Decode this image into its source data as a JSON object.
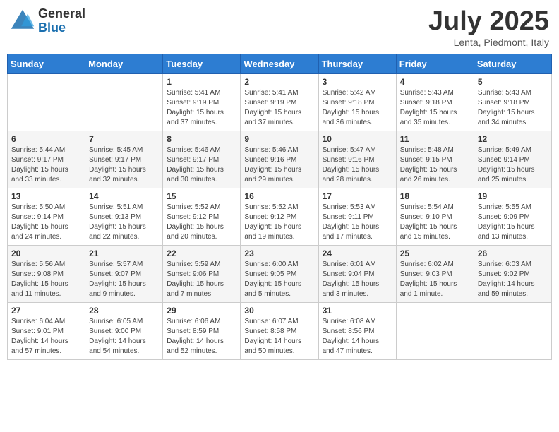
{
  "header": {
    "logo_general": "General",
    "logo_blue": "Blue",
    "month_title": "July 2025",
    "location": "Lenta, Piedmont, Italy"
  },
  "weekdays": [
    "Sunday",
    "Monday",
    "Tuesday",
    "Wednesday",
    "Thursday",
    "Friday",
    "Saturday"
  ],
  "weeks": [
    [
      {
        "day": "",
        "content": ""
      },
      {
        "day": "",
        "content": ""
      },
      {
        "day": "1",
        "sunrise": "Sunrise: 5:41 AM",
        "sunset": "Sunset: 9:19 PM",
        "daylight": "Daylight: 15 hours and 37 minutes."
      },
      {
        "day": "2",
        "sunrise": "Sunrise: 5:41 AM",
        "sunset": "Sunset: 9:19 PM",
        "daylight": "Daylight: 15 hours and 37 minutes."
      },
      {
        "day": "3",
        "sunrise": "Sunrise: 5:42 AM",
        "sunset": "Sunset: 9:18 PM",
        "daylight": "Daylight: 15 hours and 36 minutes."
      },
      {
        "day": "4",
        "sunrise": "Sunrise: 5:43 AM",
        "sunset": "Sunset: 9:18 PM",
        "daylight": "Daylight: 15 hours and 35 minutes."
      },
      {
        "day": "5",
        "sunrise": "Sunrise: 5:43 AM",
        "sunset": "Sunset: 9:18 PM",
        "daylight": "Daylight: 15 hours and 34 minutes."
      }
    ],
    [
      {
        "day": "6",
        "sunrise": "Sunrise: 5:44 AM",
        "sunset": "Sunset: 9:17 PM",
        "daylight": "Daylight: 15 hours and 33 minutes."
      },
      {
        "day": "7",
        "sunrise": "Sunrise: 5:45 AM",
        "sunset": "Sunset: 9:17 PM",
        "daylight": "Daylight: 15 hours and 32 minutes."
      },
      {
        "day": "8",
        "sunrise": "Sunrise: 5:46 AM",
        "sunset": "Sunset: 9:17 PM",
        "daylight": "Daylight: 15 hours and 30 minutes."
      },
      {
        "day": "9",
        "sunrise": "Sunrise: 5:46 AM",
        "sunset": "Sunset: 9:16 PM",
        "daylight": "Daylight: 15 hours and 29 minutes."
      },
      {
        "day": "10",
        "sunrise": "Sunrise: 5:47 AM",
        "sunset": "Sunset: 9:16 PM",
        "daylight": "Daylight: 15 hours and 28 minutes."
      },
      {
        "day": "11",
        "sunrise": "Sunrise: 5:48 AM",
        "sunset": "Sunset: 9:15 PM",
        "daylight": "Daylight: 15 hours and 26 minutes."
      },
      {
        "day": "12",
        "sunrise": "Sunrise: 5:49 AM",
        "sunset": "Sunset: 9:14 PM",
        "daylight": "Daylight: 15 hours and 25 minutes."
      }
    ],
    [
      {
        "day": "13",
        "sunrise": "Sunrise: 5:50 AM",
        "sunset": "Sunset: 9:14 PM",
        "daylight": "Daylight: 15 hours and 24 minutes."
      },
      {
        "day": "14",
        "sunrise": "Sunrise: 5:51 AM",
        "sunset": "Sunset: 9:13 PM",
        "daylight": "Daylight: 15 hours and 22 minutes."
      },
      {
        "day": "15",
        "sunrise": "Sunrise: 5:52 AM",
        "sunset": "Sunset: 9:12 PM",
        "daylight": "Daylight: 15 hours and 20 minutes."
      },
      {
        "day": "16",
        "sunrise": "Sunrise: 5:52 AM",
        "sunset": "Sunset: 9:12 PM",
        "daylight": "Daylight: 15 hours and 19 minutes."
      },
      {
        "day": "17",
        "sunrise": "Sunrise: 5:53 AM",
        "sunset": "Sunset: 9:11 PM",
        "daylight": "Daylight: 15 hours and 17 minutes."
      },
      {
        "day": "18",
        "sunrise": "Sunrise: 5:54 AM",
        "sunset": "Sunset: 9:10 PM",
        "daylight": "Daylight: 15 hours and 15 minutes."
      },
      {
        "day": "19",
        "sunrise": "Sunrise: 5:55 AM",
        "sunset": "Sunset: 9:09 PM",
        "daylight": "Daylight: 15 hours and 13 minutes."
      }
    ],
    [
      {
        "day": "20",
        "sunrise": "Sunrise: 5:56 AM",
        "sunset": "Sunset: 9:08 PM",
        "daylight": "Daylight: 15 hours and 11 minutes."
      },
      {
        "day": "21",
        "sunrise": "Sunrise: 5:57 AM",
        "sunset": "Sunset: 9:07 PM",
        "daylight": "Daylight: 15 hours and 9 minutes."
      },
      {
        "day": "22",
        "sunrise": "Sunrise: 5:59 AM",
        "sunset": "Sunset: 9:06 PM",
        "daylight": "Daylight: 15 hours and 7 minutes."
      },
      {
        "day": "23",
        "sunrise": "Sunrise: 6:00 AM",
        "sunset": "Sunset: 9:05 PM",
        "daylight": "Daylight: 15 hours and 5 minutes."
      },
      {
        "day": "24",
        "sunrise": "Sunrise: 6:01 AM",
        "sunset": "Sunset: 9:04 PM",
        "daylight": "Daylight: 15 hours and 3 minutes."
      },
      {
        "day": "25",
        "sunrise": "Sunrise: 6:02 AM",
        "sunset": "Sunset: 9:03 PM",
        "daylight": "Daylight: 15 hours and 1 minute."
      },
      {
        "day": "26",
        "sunrise": "Sunrise: 6:03 AM",
        "sunset": "Sunset: 9:02 PM",
        "daylight": "Daylight: 14 hours and 59 minutes."
      }
    ],
    [
      {
        "day": "27",
        "sunrise": "Sunrise: 6:04 AM",
        "sunset": "Sunset: 9:01 PM",
        "daylight": "Daylight: 14 hours and 57 minutes."
      },
      {
        "day": "28",
        "sunrise": "Sunrise: 6:05 AM",
        "sunset": "Sunset: 9:00 PM",
        "daylight": "Daylight: 14 hours and 54 minutes."
      },
      {
        "day": "29",
        "sunrise": "Sunrise: 6:06 AM",
        "sunset": "Sunset: 8:59 PM",
        "daylight": "Daylight: 14 hours and 52 minutes."
      },
      {
        "day": "30",
        "sunrise": "Sunrise: 6:07 AM",
        "sunset": "Sunset: 8:58 PM",
        "daylight": "Daylight: 14 hours and 50 minutes."
      },
      {
        "day": "31",
        "sunrise": "Sunrise: 6:08 AM",
        "sunset": "Sunset: 8:56 PM",
        "daylight": "Daylight: 14 hours and 47 minutes."
      },
      {
        "day": "",
        "content": ""
      },
      {
        "day": "",
        "content": ""
      }
    ]
  ]
}
